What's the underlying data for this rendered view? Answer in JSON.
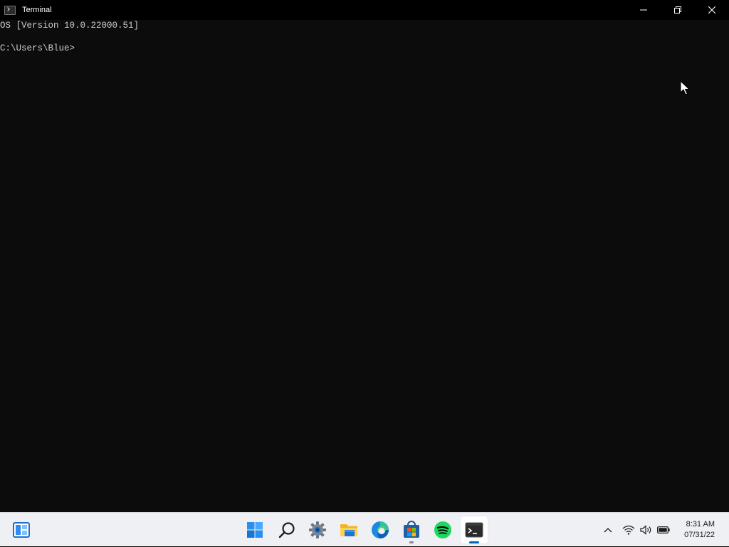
{
  "window": {
    "title": "Terminal",
    "controls": {
      "minimize_icon": "minimize-icon",
      "restore_icon": "restore-icon",
      "close_icon": "close-icon"
    }
  },
  "console": {
    "lines": [
      "OS [Version 10.0.22000.51]",
      "",
      "C:\\Users\\Blue>"
    ]
  },
  "taskbar": {
    "widgets_icon": "widgets-icon",
    "apps": [
      {
        "name": "start",
        "icon": "windows-logo-icon"
      },
      {
        "name": "search",
        "icon": "search-icon"
      },
      {
        "name": "settings",
        "icon": "gear-icon"
      },
      {
        "name": "file-explorer",
        "icon": "folder-icon"
      },
      {
        "name": "edge",
        "icon": "edge-icon"
      },
      {
        "name": "store",
        "icon": "store-icon"
      },
      {
        "name": "spotify",
        "icon": "spotify-icon"
      },
      {
        "name": "terminal",
        "icon": "terminal-icon",
        "active": true
      }
    ],
    "tray": {
      "overflow_icon": "chevron-up-icon",
      "wifi_icon": "wifi-icon",
      "volume_icon": "volume-icon",
      "battery_icon": "battery-icon"
    },
    "clock": {
      "time": "8:31 AM",
      "date": "07/31/22"
    }
  },
  "colors": {
    "terminal_bg": "#0c0c0c",
    "titlebar_bg": "#000000",
    "console_text": "#cccccc",
    "taskbar_bg": "#eef0f3",
    "accent": "#0067c0"
  }
}
